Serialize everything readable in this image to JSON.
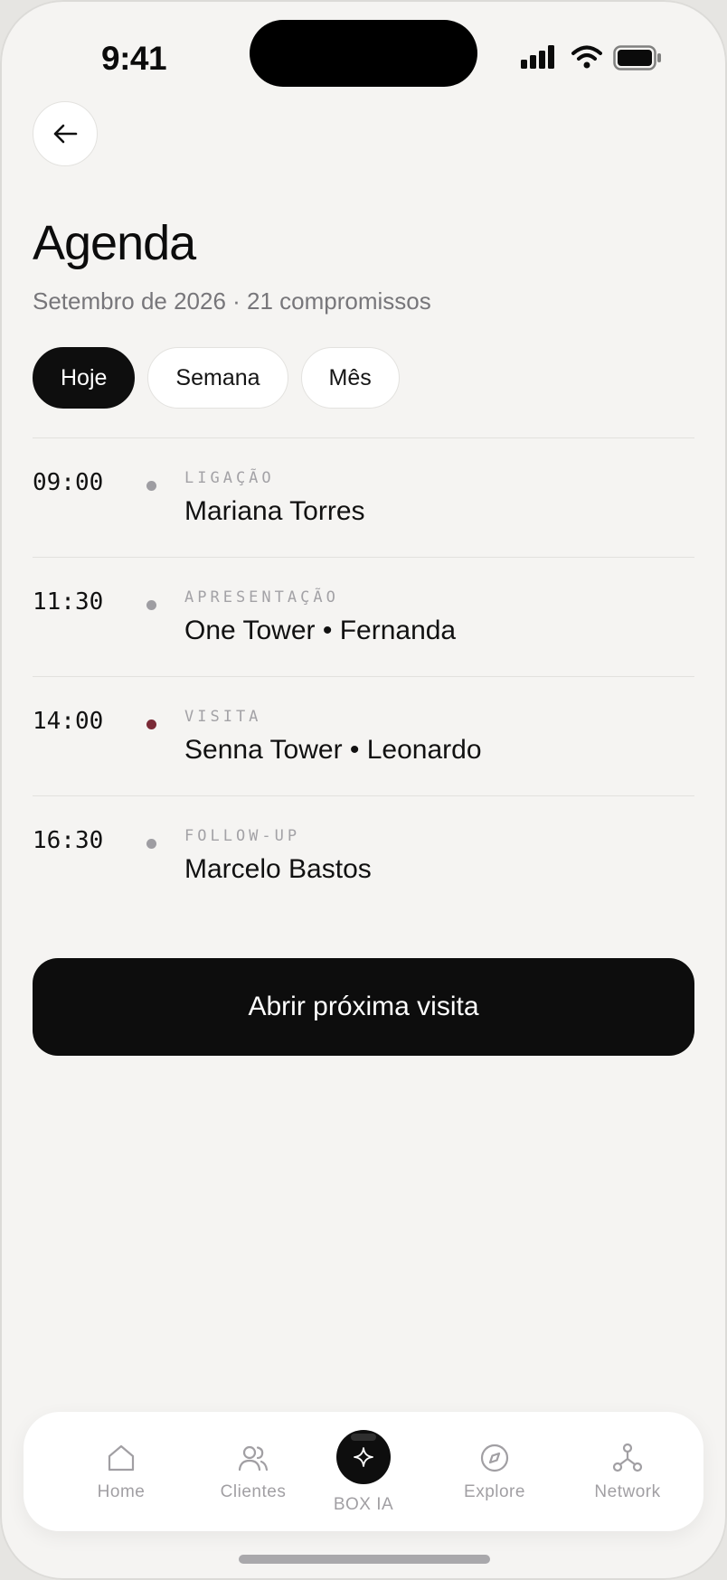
{
  "status_bar": {
    "time": "9:41"
  },
  "header": {
    "title": "Agenda",
    "subtitle": "Setembro de 2026 · 21 compromissos"
  },
  "tabs": [
    {
      "label": "Hoje",
      "active": true
    },
    {
      "label": "Semana",
      "active": false
    },
    {
      "label": "Mês",
      "active": false
    }
  ],
  "agenda": [
    {
      "time": "09:00",
      "type": "LIGAÇÃO",
      "title": "Mariana Torres",
      "dot_color": "#9e9da2"
    },
    {
      "time": "11:30",
      "type": "APRESENTAÇÃO",
      "title": "One Tower • Fernanda",
      "dot_color": "#9e9da2"
    },
    {
      "time": "14:00",
      "type": "VISITA",
      "title": "Senna Tower • Leonardo",
      "dot_color": "#7a2a36"
    },
    {
      "time": "16:30",
      "type": "FOLLOW-UP",
      "title": "Marcelo Bastos",
      "dot_color": "#9e9da2"
    }
  ],
  "primary_action": {
    "label": "Abrir próxima visita"
  },
  "bottom_nav": [
    {
      "label": "Home",
      "icon": "home-icon"
    },
    {
      "label": "Clientes",
      "icon": "users-icon"
    },
    {
      "label": "BOX IA",
      "icon": "sparkle-icon"
    },
    {
      "label": "Explore",
      "icon": "compass-icon"
    },
    {
      "label": "Network",
      "icon": "network-icon"
    }
  ],
  "colors": {
    "background": "#f5f4f2",
    "primary": "#0d0d0d",
    "accent_dot": "#7a2a36",
    "muted_text": "#77767a"
  }
}
